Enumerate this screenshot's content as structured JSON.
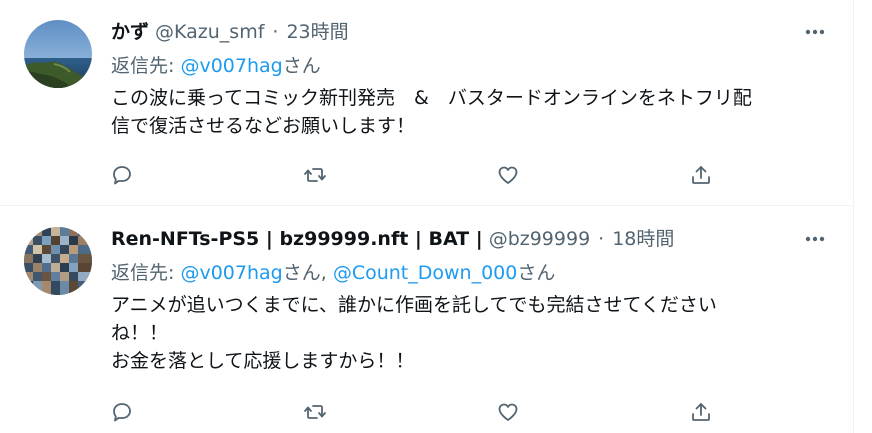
{
  "tweets": [
    {
      "name": "かず",
      "handle": "@Kazu_smf",
      "separator": "·",
      "time": "23時間",
      "reply_prefix": "返信先: ",
      "mentions": [
        "@v007hag"
      ],
      "reply_suffix": "さん",
      "mention_sep": "",
      "body_lines": [
        "この波に乗ってコミック新刊発売　&　バスタードオンラインをネトフリ配",
        "信で復活させるなどお願いします！"
      ]
    },
    {
      "name": "Ren-NFTs-PS5 | bz99999.nft | BAT |",
      "handle": "@bz99999",
      "separator": "·",
      "time": "18時間",
      "reply_prefix": "返信先: ",
      "mentions": [
        "@v007hag",
        "@Count_Down_000"
      ],
      "mention_sep": "さん, ",
      "reply_suffix": "さん",
      "body_lines": [
        "アニメが追いつくまでに、誰かに作画を託してでも完結させてください",
        "ね！！",
        "お金を落として応援しますから！！"
      ]
    }
  ],
  "icons": {
    "more": "more-horizontal-icon",
    "reply": "reply-bubble-icon",
    "retweet": "retweet-arrows-icon",
    "like": "heart-icon",
    "share": "share-upload-icon"
  },
  "colors": {
    "text": "#0f1419",
    "secondary": "#536471",
    "link": "#1d9bf0",
    "divider": "#eff3f4"
  }
}
